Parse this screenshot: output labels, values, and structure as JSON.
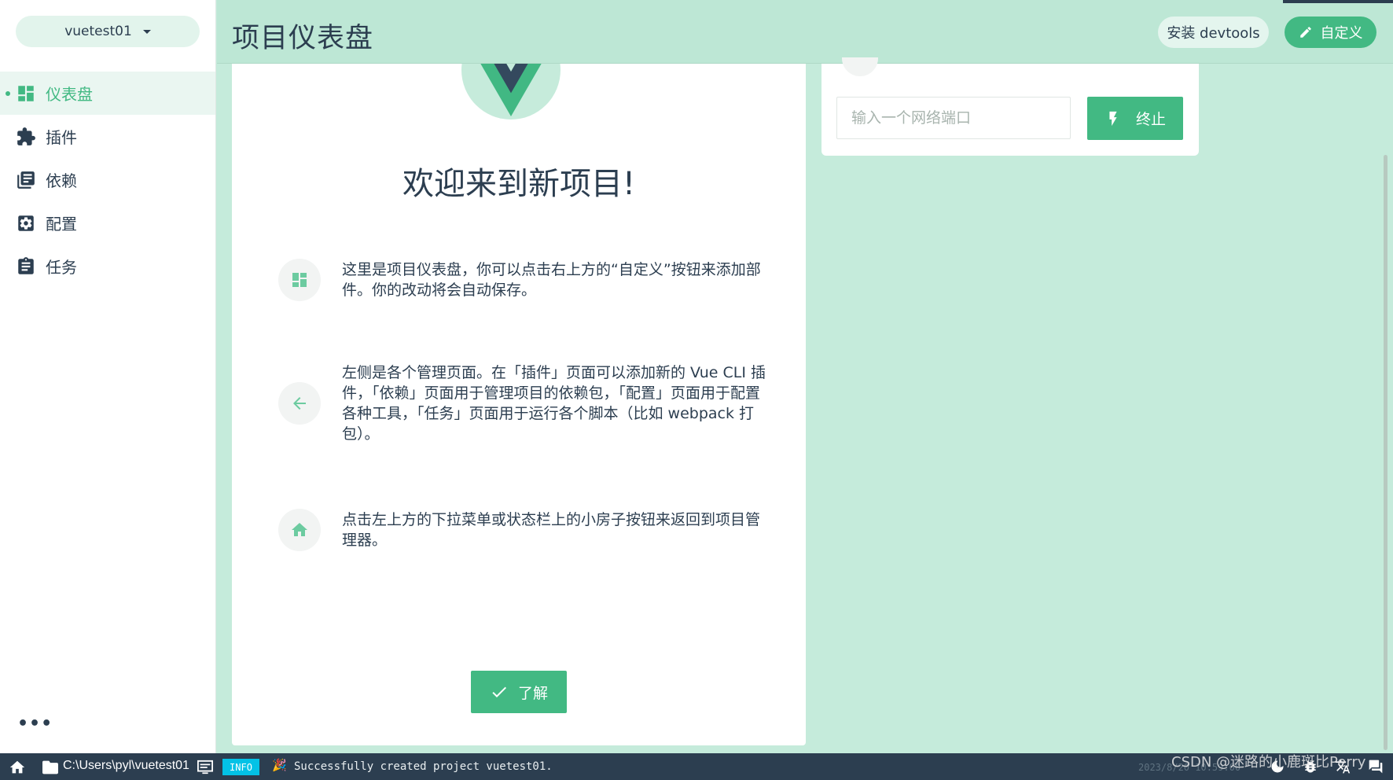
{
  "sidebar": {
    "project_name": "vuetest01",
    "nav": [
      {
        "label": "仪表盘",
        "icon": "dashboard-icon",
        "active": true
      },
      {
        "label": "插件",
        "icon": "puzzle-icon",
        "active": false
      },
      {
        "label": "依赖",
        "icon": "library-books-icon",
        "active": false
      },
      {
        "label": "配置",
        "icon": "settings-box-icon",
        "active": false
      },
      {
        "label": "任务",
        "icon": "clipboard-icon",
        "active": false
      }
    ],
    "more_label": "•••"
  },
  "header": {
    "title": "项目仪表盘",
    "devtools_label": "安装 devtools",
    "customize_label": "自定义"
  },
  "welcome": {
    "title": "欢迎来到新项目!",
    "tips": [
      {
        "icon": "dashboard-icon",
        "text": "这里是项目仪表盘，你可以点击右上方的“自定义”按钮来添加部件。你的改动将会自动保存。"
      },
      {
        "icon": "arrow-left-icon",
        "text": "左侧是各个管理页面。在「插件」页面可以添加新的 Vue CLI 插件，「依赖」页面用于管理项目的依赖包，「配置」页面用于配置各种工具，「任务」页面用于运行各个脚本（比如 webpack 打包）。"
      },
      {
        "icon": "home-icon",
        "text": "点击左上方的下拉菜单或状态栏上的小房子按钮来返回到项目管理器。"
      }
    ],
    "ok_label": "了解"
  },
  "port_widget": {
    "placeholder": "输入一个网络端口",
    "stop_label": "终止"
  },
  "statusbar": {
    "path": "C:\\Users\\pyl\\vuetest01",
    "log_level": "INFO",
    "party_glyph": "🎉",
    "message": "Successfully created project vuetest01.",
    "timestamp": "2023/8/20 10:59:00"
  },
  "watermark": "CSDN @迷路的小鹿斑比Perry",
  "colors": {
    "accent": "#42b983",
    "header_bg": "#bde7d5",
    "page_bg": "#c5ebdb",
    "statusbar_bg": "#2c3e50",
    "info_badge": "#03c2e6"
  }
}
